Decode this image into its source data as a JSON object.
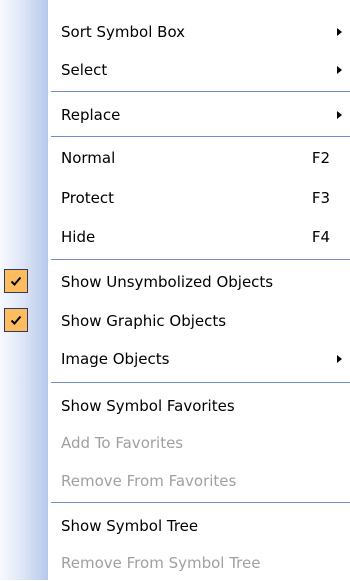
{
  "menu": {
    "items": [
      {
        "label": "Sort Symbol Box",
        "submenu": true
      },
      {
        "label": "Select",
        "submenu": true
      },
      {
        "label": "Replace",
        "submenu": true
      },
      {
        "label": "Normal",
        "shortcut": "F2"
      },
      {
        "label": "Protect",
        "shortcut": "F3"
      },
      {
        "label": "Hide",
        "shortcut": "F4"
      },
      {
        "label": "Show Unsymbolized Objects",
        "checked": true
      },
      {
        "label": "Show Graphic Objects",
        "checked": true
      },
      {
        "label": "Image Objects",
        "submenu": true
      },
      {
        "label": "Show Symbol Favorites"
      },
      {
        "label": "Add To Favorites",
        "disabled": true
      },
      {
        "label": "Remove From Favorites",
        "disabled": true
      },
      {
        "label": "Show Symbol Tree"
      },
      {
        "label": "Remove From Symbol Tree",
        "disabled": true
      }
    ]
  },
  "colors": {
    "check_fill": "#fdbd5e",
    "check_border": "#2d3a66",
    "separator": "#6f8fcb",
    "disabled_text": "#a0a0a0"
  },
  "icons": {
    "check": "checkmark-icon",
    "submenu": "submenu-arrow-icon"
  }
}
